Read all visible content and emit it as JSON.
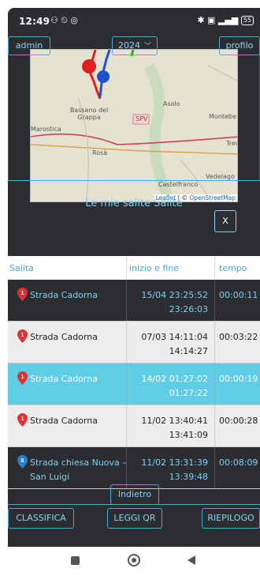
{
  "status": {
    "time": "12:49",
    "icons_left": "⚇ ⏲ ◎",
    "icons_right": "✱ ▣ ▂▄▆",
    "battery": "55"
  },
  "topbar": {
    "admin_label": "admin",
    "year": "2024",
    "profile_label": "profilo"
  },
  "map": {
    "labels": {
      "asolo": "Asolo",
      "bassano": "Bassano del Grappa",
      "marostica": "Marostica",
      "rosa": "Rosà",
      "montebe": "Montebe",
      "trev": "Trev",
      "vedelago": "Vedelago",
      "castelfranco": "Castelfranco",
      "spv": "SPV"
    },
    "attribution_leaflet": "Leaflet",
    "attribution_sep": " | © ",
    "attribution_osm": "OpenStreetMap"
  },
  "header": {
    "title": "Le mie salite Salite",
    "close_label": "X"
  },
  "table": {
    "columns": {
      "salita": "Salita",
      "inizio_fine": "inizio e fine",
      "tempo": "tempo"
    },
    "rows": [
      {
        "pin": "1",
        "pin_color": "#e03030",
        "name": "Strada Cadorna",
        "start": "15/04 23:25:52",
        "end": "23:26:03",
        "duration": "00:00:11"
      },
      {
        "pin": "1",
        "pin_color": "#e03030",
        "name": "Strada Cadorna",
        "start": "07/03 14:11:04",
        "end": "14:14:27",
        "duration": "00:03:22"
      },
      {
        "pin": "1",
        "pin_color": "#e03030",
        "name": "Strada Cadorna",
        "start": "14/02 01:27:02",
        "end": "01:27:22",
        "duration": "00:00:19"
      },
      {
        "pin": "1",
        "pin_color": "#e03030",
        "name": "Strada Cadorna",
        "start": "11/02 13:40:41",
        "end": "13:41:09",
        "duration": "00:00:28"
      },
      {
        "pin": "8",
        "pin_color": "#2a80d0",
        "name": "Strada chiesa Nuova – San Luigi",
        "start": "11/02 13:31:39",
        "end": "13:39:48",
        "duration": "00:08:09"
      }
    ]
  },
  "footer": {
    "back_label": "Indietro",
    "classifica_label": "CLASSIFICA",
    "leggi_label": "LEGGI QR",
    "riepilogo_label": "RIEPILOGO"
  },
  "colors": {
    "accent": "#4aa8d8",
    "highlight": "#5fcde6",
    "background": "#2b2d30"
  }
}
